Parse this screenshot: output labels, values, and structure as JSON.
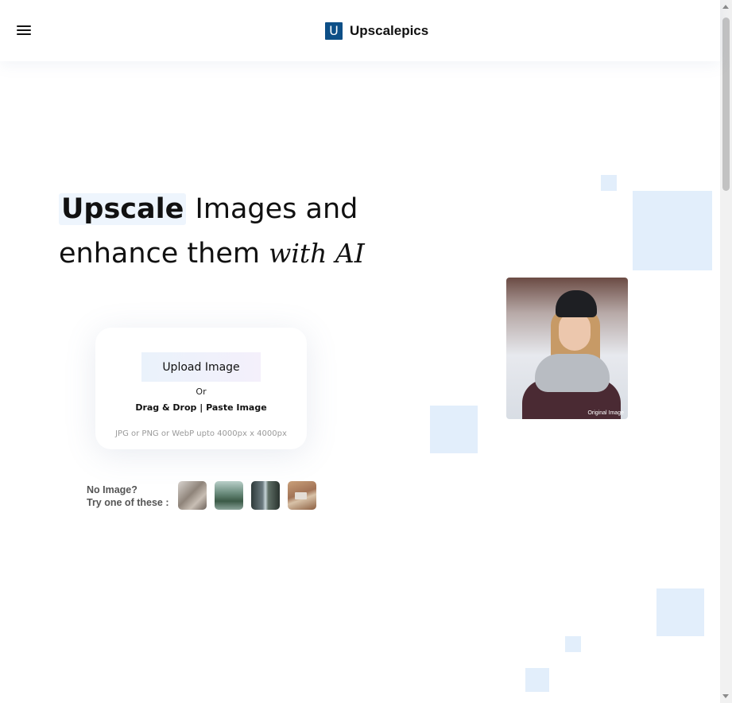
{
  "header": {
    "logo_letter": "U",
    "brand_name": "Upscalepics"
  },
  "hero": {
    "title_highlight": "Upscale",
    "title_line1_rest": " Images and",
    "title_line2": "enhance them ",
    "title_script": "with AI"
  },
  "upload": {
    "button_label": "Upload Image",
    "or_text": "Or",
    "drag_text": "Drag & Drop | Paste Image",
    "hint_text": "JPG or PNG or WebP upto 4000px x 4000px"
  },
  "samples": {
    "label_line1": "No Image?",
    "label_line2": "Try one of these :"
  },
  "preview": {
    "caption": "Original Image"
  },
  "colors": {
    "brand": "#0d4f87",
    "accent_light": "#e2eefb"
  }
}
